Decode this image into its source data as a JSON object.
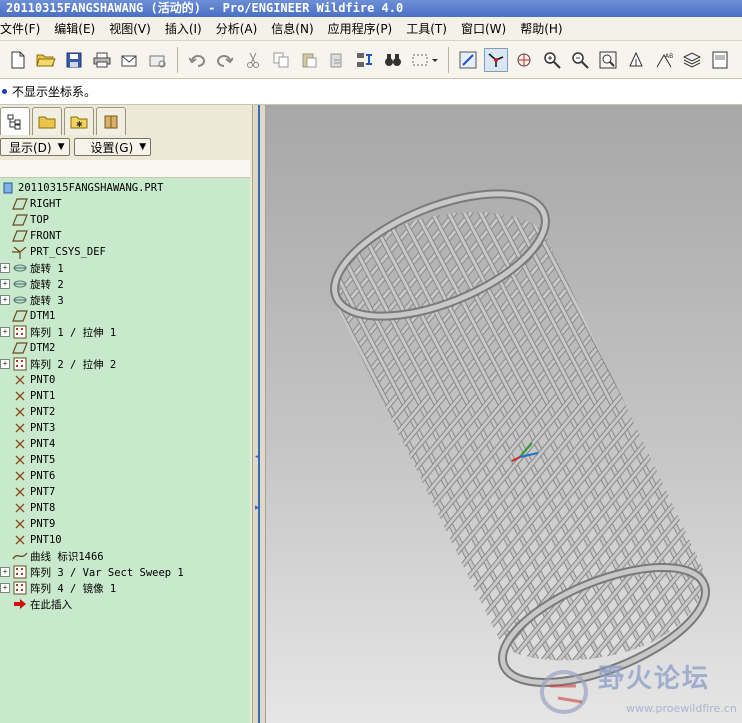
{
  "window": {
    "title": "20110315FANGSHAWANG (活动的) - Pro/ENGINEER Wildfire 4.0"
  },
  "menu": [
    "文件(F)",
    "编辑(E)",
    "视图(V)",
    "插入(I)",
    "分析(A)",
    "信息(N)",
    "应用程序(P)",
    "工具(T)",
    "窗口(W)",
    "帮助(H)"
  ],
  "message": "不显示坐标系。",
  "panel": {
    "show_label": "显示(D)",
    "settings_label": "设置(G)"
  },
  "tree": [
    {
      "label": "20110315FANGSHAWANG.PRT",
      "icon": "part-icon",
      "expander": false
    },
    {
      "label": "RIGHT",
      "icon": "datum-plane-icon",
      "expander": false
    },
    {
      "label": "TOP",
      "icon": "datum-plane-icon",
      "expander": false
    },
    {
      "label": "FRONT",
      "icon": "datum-plane-icon",
      "expander": false
    },
    {
      "label": "PRT_CSYS_DEF",
      "icon": "csys-icon",
      "expander": false
    },
    {
      "label": "旋转 1",
      "icon": "revolve-icon",
      "expander": true
    },
    {
      "label": "旋转 2",
      "icon": "revolve-icon",
      "expander": true
    },
    {
      "label": "旋转 3",
      "icon": "revolve-icon",
      "expander": true
    },
    {
      "label": "DTM1",
      "icon": "datum-plane-icon",
      "expander": false
    },
    {
      "label": "阵列 1 / 拉伸 1",
      "icon": "pattern-icon",
      "expander": true
    },
    {
      "label": "DTM2",
      "icon": "datum-plane-icon",
      "expander": false
    },
    {
      "label": "阵列 2 / 拉伸 2",
      "icon": "pattern-icon",
      "expander": true
    },
    {
      "label": "PNT0",
      "icon": "datum-point-icon",
      "expander": false
    },
    {
      "label": "PNT1",
      "icon": "datum-point-icon",
      "expander": false
    },
    {
      "label": "PNT2",
      "icon": "datum-point-icon",
      "expander": false
    },
    {
      "label": "PNT3",
      "icon": "datum-point-icon",
      "expander": false
    },
    {
      "label": "PNT4",
      "icon": "datum-point-icon",
      "expander": false
    },
    {
      "label": "PNT5",
      "icon": "datum-point-icon",
      "expander": false
    },
    {
      "label": "PNT6",
      "icon": "datum-point-icon",
      "expander": false
    },
    {
      "label": "PNT7",
      "icon": "datum-point-icon",
      "expander": false
    },
    {
      "label": "PNT8",
      "icon": "datum-point-icon",
      "expander": false
    },
    {
      "label": "PNT9",
      "icon": "datum-point-icon",
      "expander": false
    },
    {
      "label": "PNT10",
      "icon": "datum-point-icon",
      "expander": false
    },
    {
      "label": "曲线 标识1466",
      "icon": "curve-icon",
      "expander": false
    },
    {
      "label": "阵列 3 / Var Sect Sweep 1",
      "icon": "pattern-icon",
      "expander": true
    },
    {
      "label": "阵列 4 / 镜像 1",
      "icon": "pattern-icon",
      "expander": true
    },
    {
      "label": "在此插入",
      "icon": "insert-here-arrow-icon",
      "expander": false
    }
  ],
  "watermark": {
    "title": "野火论坛",
    "url": "www.proewildfire.cn"
  },
  "colors": {
    "title_bar": "#4a6fc4",
    "tree_bg": "#c8e9cb",
    "tube": "#c8c8c8",
    "insert_arrow": "#d01010"
  }
}
